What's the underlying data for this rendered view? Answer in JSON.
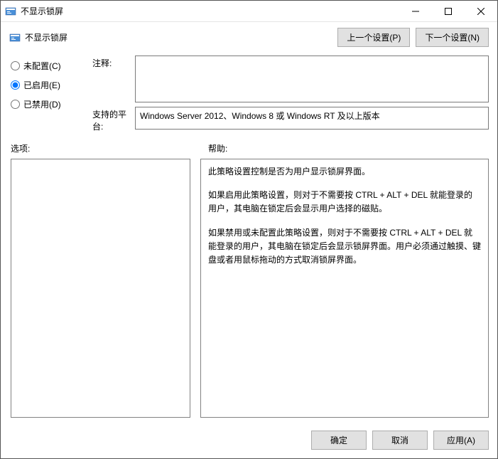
{
  "window": {
    "title": "不显示锁屏"
  },
  "header": {
    "title": "不显示锁屏",
    "prev_button": "上一个设置(P)",
    "next_button": "下一个设置(N)"
  },
  "radios": {
    "not_configured": "未配置(C)",
    "enabled": "已启用(E)",
    "disabled": "已禁用(D)",
    "selected": "enabled"
  },
  "fields": {
    "comment_label": "注释:",
    "comment_value": "",
    "platform_label": "支持的平台:",
    "platform_value": "Windows Server 2012、Windows 8 或 Windows RT 及以上版本"
  },
  "panels": {
    "options_label": "选项:",
    "help_label": "帮助:",
    "help_paragraphs": {
      "p1": "此策略设置控制是否为用户显示锁屏界面。",
      "p2": "如果启用此策略设置，则对于不需要按 CTRL + ALT + DEL  就能登录的用户，其电脑在锁定后会显示用户选择的磁贴。",
      "p3": "如果禁用或未配置此策略设置，则对于不需要按 CTRL + ALT + DEL 就能登录的用户，其电脑在锁定后会显示锁屏界面。用户必须通过触摸、键盘或者用鼠标拖动的方式取消锁屏界面。"
    }
  },
  "footer": {
    "ok": "确定",
    "cancel": "取消",
    "apply": "应用(A)"
  }
}
